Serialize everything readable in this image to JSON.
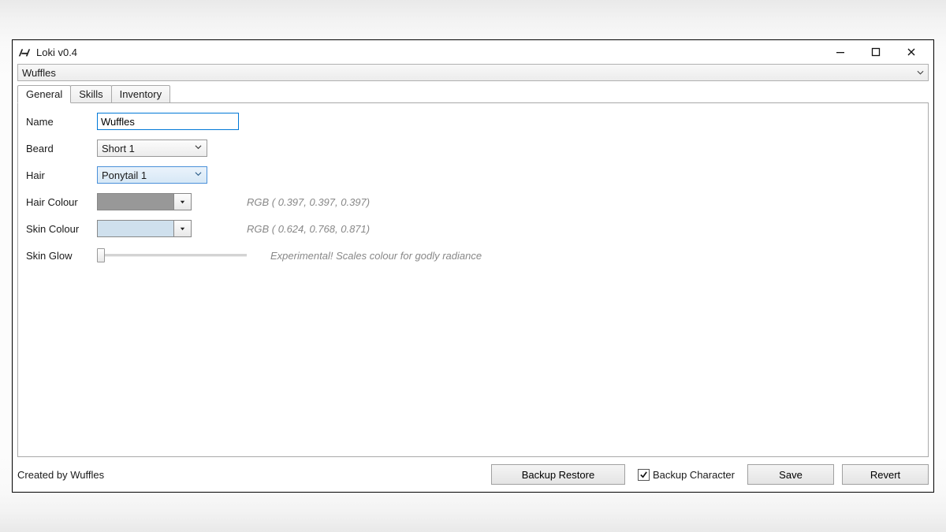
{
  "window": {
    "title": "Loki v0.4"
  },
  "menubar": {
    "character_select": "Wuffles"
  },
  "tabs": [
    {
      "label": "General"
    },
    {
      "label": "Skills"
    },
    {
      "label": "Inventory"
    }
  ],
  "general": {
    "name_label": "Name",
    "name_value": "Wuffles",
    "beard_label": "Beard",
    "beard_value": "Short 1",
    "hair_label": "Hair",
    "hair_value": "Ponytail 1",
    "hair_colour_label": "Hair Colour",
    "hair_colour_hint": "RGB ( 0.397, 0.397, 0.397)",
    "skin_colour_label": "Skin Colour",
    "skin_colour_hint": "RGB ( 0.624, 0.768, 0.871)",
    "skin_glow_label": "Skin Glow",
    "skin_glow_hint": "Experimental! Scales colour for godly radiance"
  },
  "footer": {
    "credit": "Created by Wuffles",
    "backup_restore": "Backup Restore",
    "backup_character": "Backup Character",
    "save": "Save",
    "revert": "Revert"
  }
}
